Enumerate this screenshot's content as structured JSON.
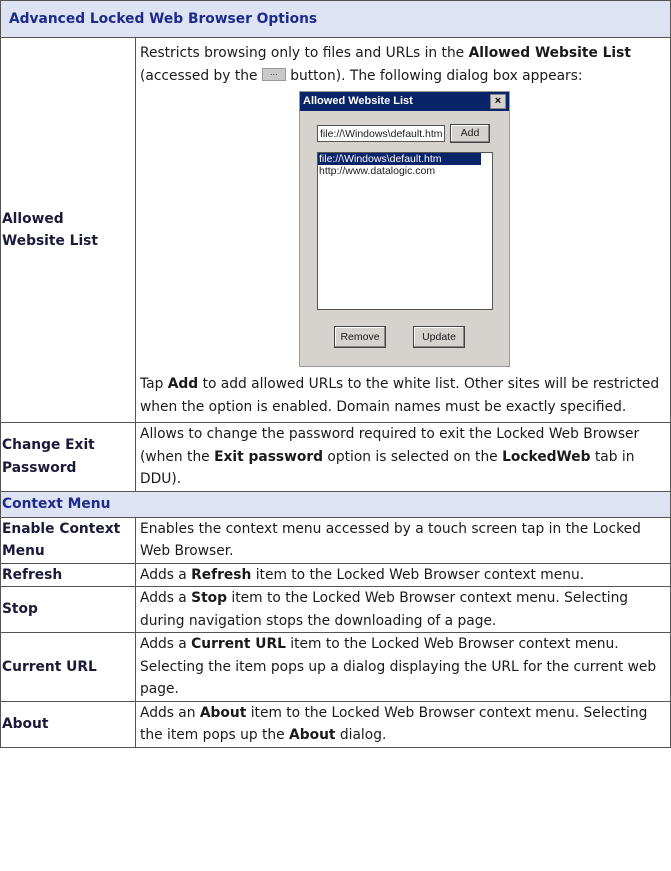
{
  "header": {
    "title": "Advanced Locked Web Browser Options"
  },
  "allowed": {
    "name": "Allowed Website List",
    "desc_a": "Restricts browsing only to files and URLs in the ",
    "desc_b": "Allowed Website List",
    "desc_c": " (accessed by the ",
    "desc_btn": "...",
    "desc_d": " button). The following dialog box appears:",
    "tap_a": "Tap ",
    "tap_b": "Add",
    "tap_c": " to add allowed URLs to the white list. Other sites will be restricted when the option is enabled. Domain names must be exactly specified."
  },
  "dialog": {
    "title": "Allowed Website List",
    "close": "×",
    "input_value": "file://\\Windows\\default.htm",
    "add_label": "Add",
    "list": [
      "file://\\Windows\\default.htm",
      "http://www.datalogic.com"
    ],
    "remove_label": "Remove",
    "update_label": "Update"
  },
  "change_exit": {
    "name": "Change Exit Password",
    "a": "Allows to change the password required to exit the Locked Web Browser (when the ",
    "b": "Exit password",
    "c": " option is selected on the ",
    "d": "LockedWeb",
    "e": " tab in DDU)."
  },
  "context_menu": {
    "title": "Context Menu"
  },
  "enable_context": {
    "name": "Enable Context Menu",
    "desc": "Enables the context menu accessed by a touch screen tap in the Locked Web Browser."
  },
  "refresh": {
    "name": "Refresh",
    "a": "Adds a ",
    "b": "Refresh",
    "c": " item to the Locked Web Browser context menu."
  },
  "stop": {
    "name": "Stop",
    "a": "Adds a ",
    "b": "Stop",
    "c": " item to the Locked Web Browser context menu. Selecting during navigation stops the downloading of a page."
  },
  "current_url": {
    "name": "Current URL",
    "a": "Adds a ",
    "b": "Current URL",
    "c": " item to the Locked Web Browser context menu. Selecting the item pops up a dialog displaying the URL for the current web page."
  },
  "about": {
    "name": "About",
    "a": "Adds an ",
    "b": "About",
    "c": " item to the Locked Web Browser context menu. Selecting the item pops up the ",
    "d": "About",
    "e": " dialog."
  }
}
